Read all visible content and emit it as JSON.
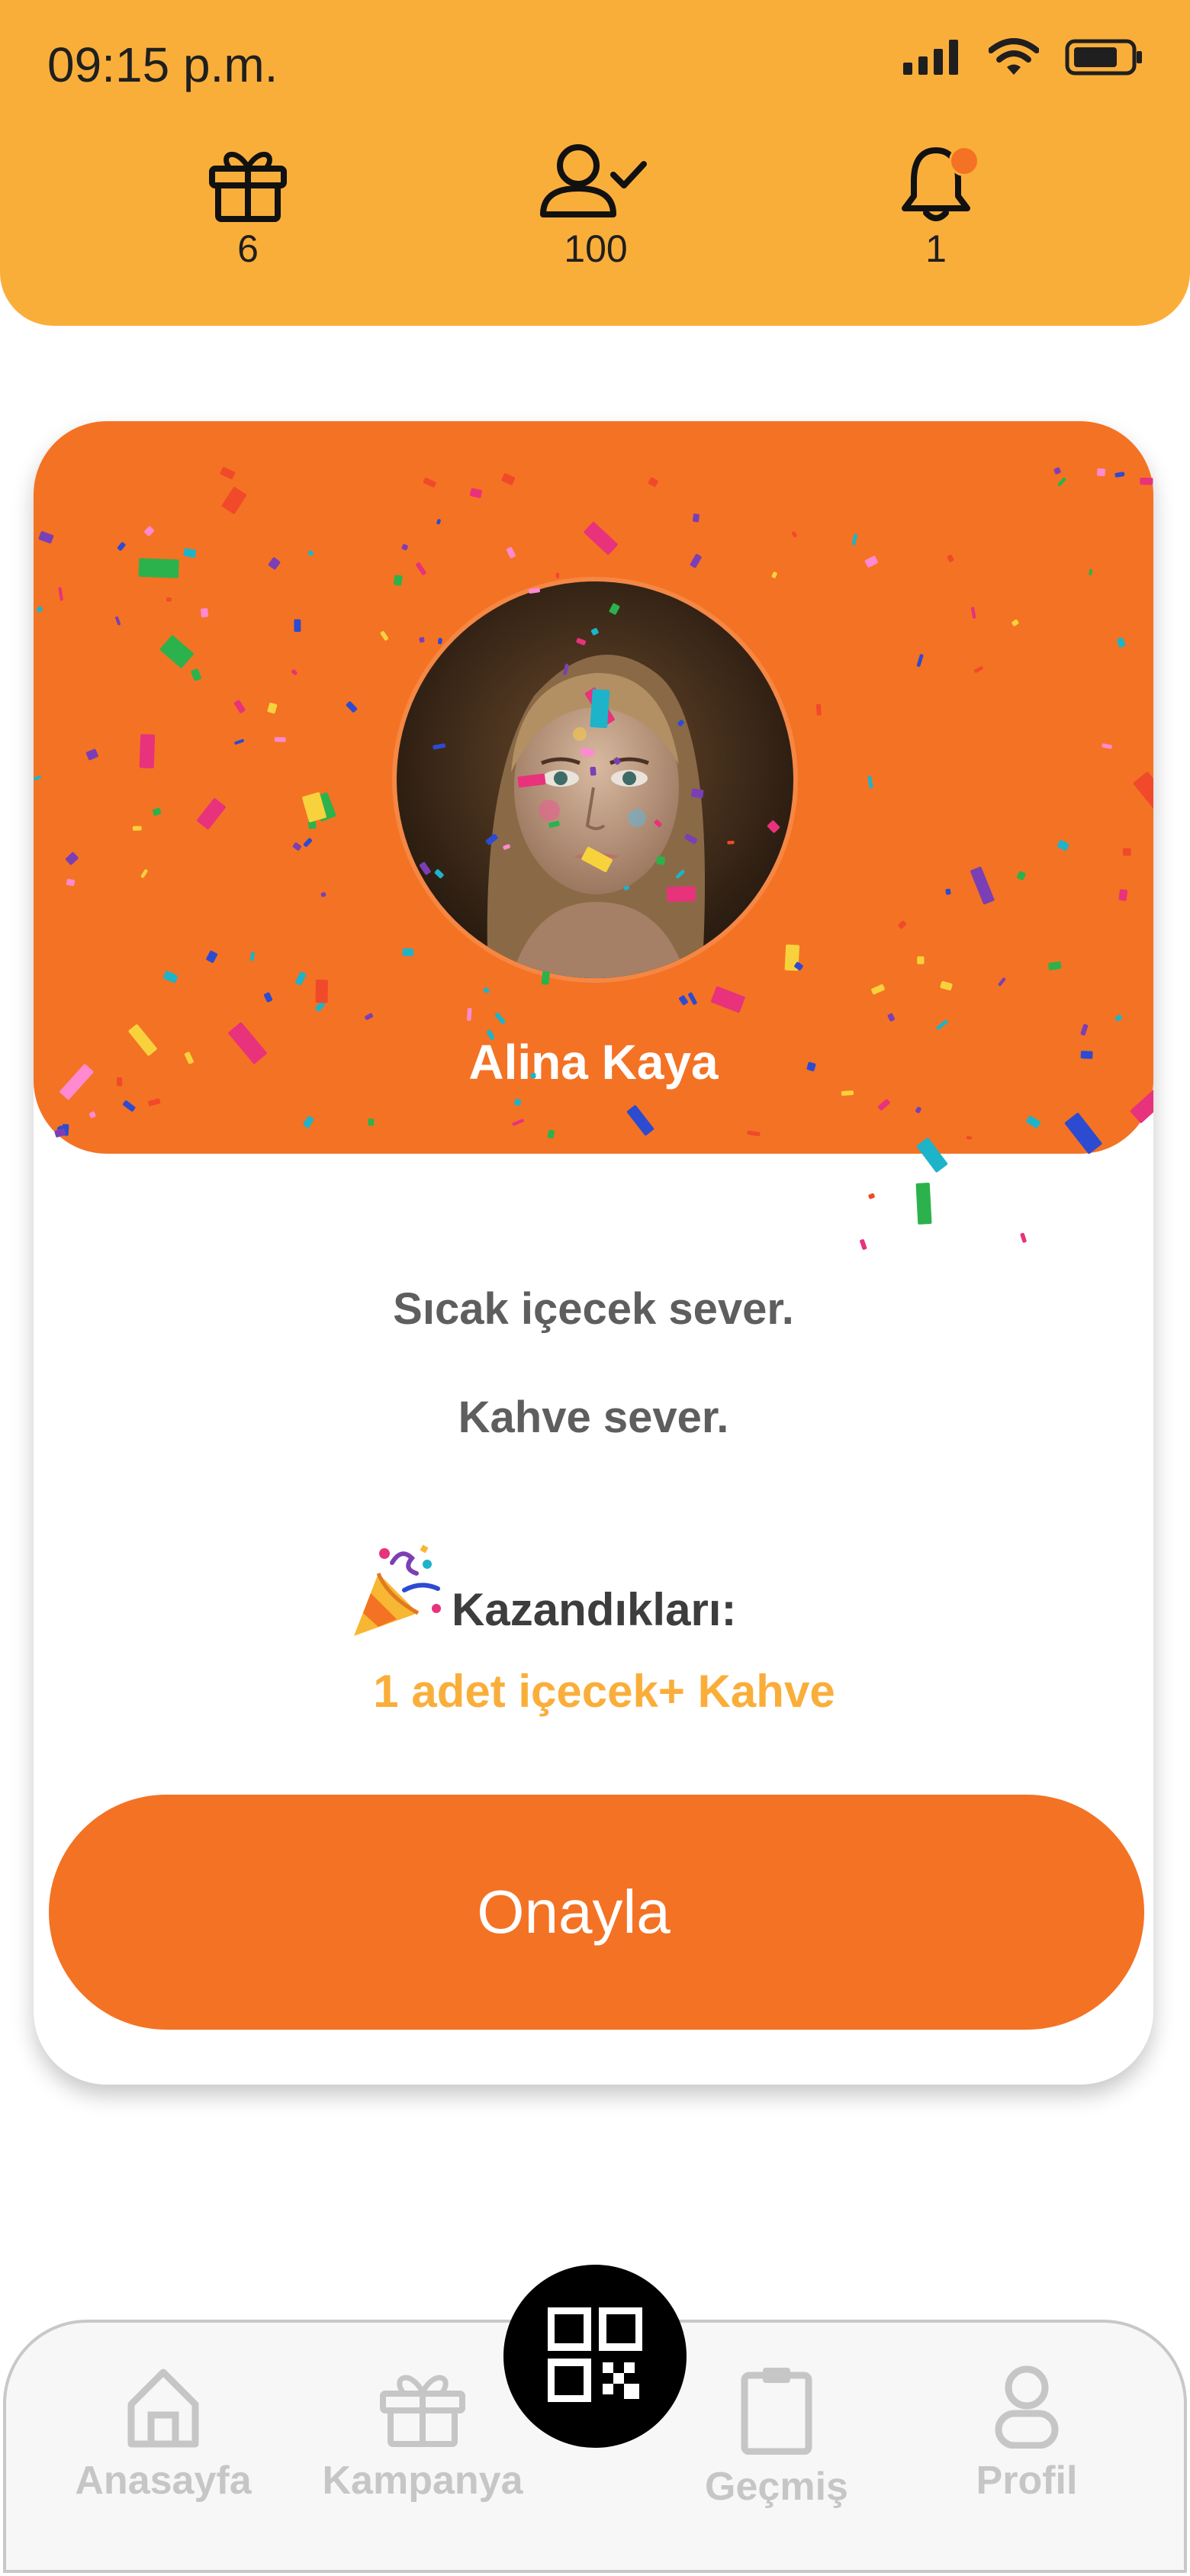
{
  "status_bar": {
    "time": "09:15 p.m."
  },
  "stats": {
    "gifts": "6",
    "followers": "100",
    "notifications": "1"
  },
  "profile": {
    "name": "Alina Kaya",
    "traits": [
      "Sıcak içecek sever.",
      "Kahve sever."
    ],
    "winnings_label": "Kazandıkları:",
    "winnings_value": "1 adet içecek+ Kahve"
  },
  "actions": {
    "confirm_label": "Onayla"
  },
  "nav": {
    "home": "Anasayfa",
    "campaign": "Kampanya",
    "history": "Geçmiş",
    "profile": "Profil"
  },
  "colors": {
    "header_bg": "#FAAE3A",
    "accent_orange": "#F47224",
    "winnings_text": "#FAAE3A",
    "nav_inactive": "#c6c6c6"
  },
  "icons": [
    "gift-icon",
    "user-check-icon",
    "bell-icon",
    "signal-icon",
    "wifi-icon",
    "battery-icon",
    "party-popper-icon",
    "home-icon",
    "campaign-gift-icon",
    "clipboard-icon",
    "profile-icon",
    "qr-code-icon"
  ]
}
